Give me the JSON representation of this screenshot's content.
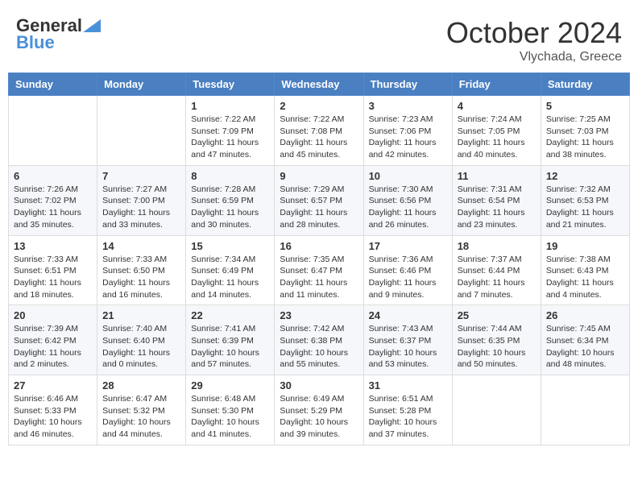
{
  "header": {
    "logo_line1": "General",
    "logo_line2": "Blue",
    "month": "October 2024",
    "location": "Vlychada, Greece"
  },
  "days_of_week": [
    "Sunday",
    "Monday",
    "Tuesday",
    "Wednesday",
    "Thursday",
    "Friday",
    "Saturday"
  ],
  "weeks": [
    [
      {
        "day": "",
        "data": ""
      },
      {
        "day": "",
        "data": ""
      },
      {
        "day": "1",
        "data": "Sunrise: 7:22 AM\nSunset: 7:09 PM\nDaylight: 11 hours and 47 minutes."
      },
      {
        "day": "2",
        "data": "Sunrise: 7:22 AM\nSunset: 7:08 PM\nDaylight: 11 hours and 45 minutes."
      },
      {
        "day": "3",
        "data": "Sunrise: 7:23 AM\nSunset: 7:06 PM\nDaylight: 11 hours and 42 minutes."
      },
      {
        "day": "4",
        "data": "Sunrise: 7:24 AM\nSunset: 7:05 PM\nDaylight: 11 hours and 40 minutes."
      },
      {
        "day": "5",
        "data": "Sunrise: 7:25 AM\nSunset: 7:03 PM\nDaylight: 11 hours and 38 minutes."
      }
    ],
    [
      {
        "day": "6",
        "data": "Sunrise: 7:26 AM\nSunset: 7:02 PM\nDaylight: 11 hours and 35 minutes."
      },
      {
        "day": "7",
        "data": "Sunrise: 7:27 AM\nSunset: 7:00 PM\nDaylight: 11 hours and 33 minutes."
      },
      {
        "day": "8",
        "data": "Sunrise: 7:28 AM\nSunset: 6:59 PM\nDaylight: 11 hours and 30 minutes."
      },
      {
        "day": "9",
        "data": "Sunrise: 7:29 AM\nSunset: 6:57 PM\nDaylight: 11 hours and 28 minutes."
      },
      {
        "day": "10",
        "data": "Sunrise: 7:30 AM\nSunset: 6:56 PM\nDaylight: 11 hours and 26 minutes."
      },
      {
        "day": "11",
        "data": "Sunrise: 7:31 AM\nSunset: 6:54 PM\nDaylight: 11 hours and 23 minutes."
      },
      {
        "day": "12",
        "data": "Sunrise: 7:32 AM\nSunset: 6:53 PM\nDaylight: 11 hours and 21 minutes."
      }
    ],
    [
      {
        "day": "13",
        "data": "Sunrise: 7:33 AM\nSunset: 6:51 PM\nDaylight: 11 hours and 18 minutes."
      },
      {
        "day": "14",
        "data": "Sunrise: 7:33 AM\nSunset: 6:50 PM\nDaylight: 11 hours and 16 minutes."
      },
      {
        "day": "15",
        "data": "Sunrise: 7:34 AM\nSunset: 6:49 PM\nDaylight: 11 hours and 14 minutes."
      },
      {
        "day": "16",
        "data": "Sunrise: 7:35 AM\nSunset: 6:47 PM\nDaylight: 11 hours and 11 minutes."
      },
      {
        "day": "17",
        "data": "Sunrise: 7:36 AM\nSunset: 6:46 PM\nDaylight: 11 hours and 9 minutes."
      },
      {
        "day": "18",
        "data": "Sunrise: 7:37 AM\nSunset: 6:44 PM\nDaylight: 11 hours and 7 minutes."
      },
      {
        "day": "19",
        "data": "Sunrise: 7:38 AM\nSunset: 6:43 PM\nDaylight: 11 hours and 4 minutes."
      }
    ],
    [
      {
        "day": "20",
        "data": "Sunrise: 7:39 AM\nSunset: 6:42 PM\nDaylight: 11 hours and 2 minutes."
      },
      {
        "day": "21",
        "data": "Sunrise: 7:40 AM\nSunset: 6:40 PM\nDaylight: 11 hours and 0 minutes."
      },
      {
        "day": "22",
        "data": "Sunrise: 7:41 AM\nSunset: 6:39 PM\nDaylight: 10 hours and 57 minutes."
      },
      {
        "day": "23",
        "data": "Sunrise: 7:42 AM\nSunset: 6:38 PM\nDaylight: 10 hours and 55 minutes."
      },
      {
        "day": "24",
        "data": "Sunrise: 7:43 AM\nSunset: 6:37 PM\nDaylight: 10 hours and 53 minutes."
      },
      {
        "day": "25",
        "data": "Sunrise: 7:44 AM\nSunset: 6:35 PM\nDaylight: 10 hours and 50 minutes."
      },
      {
        "day": "26",
        "data": "Sunrise: 7:45 AM\nSunset: 6:34 PM\nDaylight: 10 hours and 48 minutes."
      }
    ],
    [
      {
        "day": "27",
        "data": "Sunrise: 6:46 AM\nSunset: 5:33 PM\nDaylight: 10 hours and 46 minutes."
      },
      {
        "day": "28",
        "data": "Sunrise: 6:47 AM\nSunset: 5:32 PM\nDaylight: 10 hours and 44 minutes."
      },
      {
        "day": "29",
        "data": "Sunrise: 6:48 AM\nSunset: 5:30 PM\nDaylight: 10 hours and 41 minutes."
      },
      {
        "day": "30",
        "data": "Sunrise: 6:49 AM\nSunset: 5:29 PM\nDaylight: 10 hours and 39 minutes."
      },
      {
        "day": "31",
        "data": "Sunrise: 6:51 AM\nSunset: 5:28 PM\nDaylight: 10 hours and 37 minutes."
      },
      {
        "day": "",
        "data": ""
      },
      {
        "day": "",
        "data": ""
      }
    ]
  ]
}
